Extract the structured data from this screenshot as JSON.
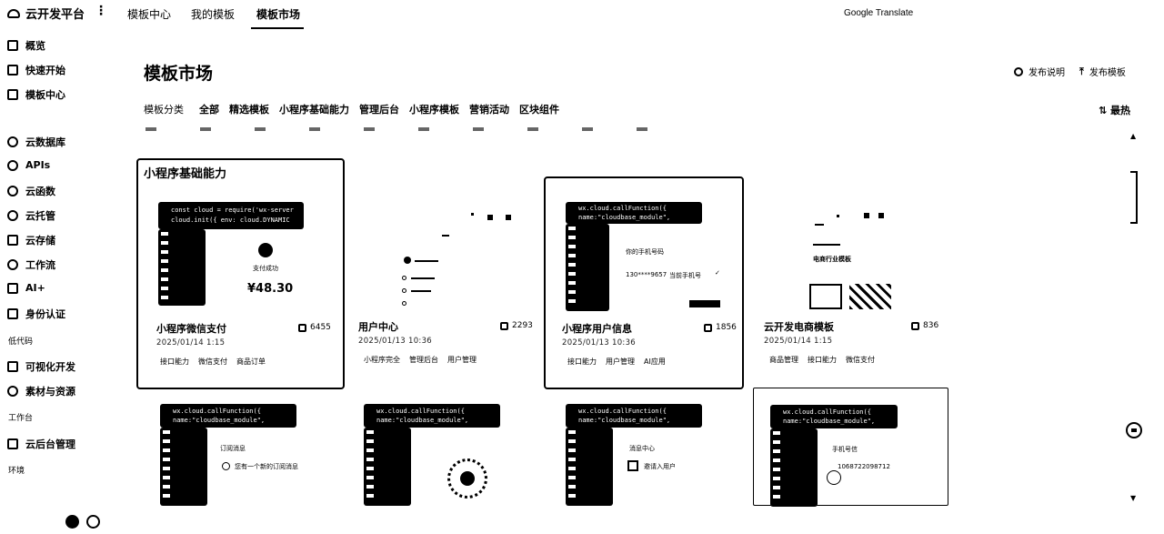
{
  "app": {
    "title": "云开发平台"
  },
  "top_tabs": [
    {
      "label": "模板中心"
    },
    {
      "label": "我的模板"
    },
    {
      "label": "模板市场"
    }
  ],
  "google_translate": "Google Translate",
  "sidebar": {
    "items_a": [
      {
        "label": "概览"
      },
      {
        "label": "快速开始"
      },
      {
        "label": "模板中心"
      }
    ],
    "items_b": [
      {
        "label": "云数据库"
      },
      {
        "label": "APIs"
      },
      {
        "label": "云函数"
      },
      {
        "label": "云托管"
      },
      {
        "label": "云存储"
      },
      {
        "label": "工作流"
      },
      {
        "label": "AI+"
      },
      {
        "label": "身份认证"
      }
    ],
    "section_lowcode": "低代码",
    "items_c": [
      {
        "label": "可视化开发"
      },
      {
        "label": "素材与资源"
      }
    ],
    "section_workbench": "工作台",
    "items_d": [
      {
        "label": "云后台管理"
      }
    ],
    "section_env": "环境"
  },
  "page": {
    "title": "模板市场",
    "help": "发布说明",
    "publish": "发布模板",
    "sort": "最热"
  },
  "filters": {
    "label": "模板分类",
    "options": [
      "全部",
      "精选模板",
      "小程序基础能力",
      "管理后台",
      "小程序模板",
      "营销活动",
      "区块组件"
    ]
  },
  "group_heading": "小程序基础能力",
  "cards": [
    {
      "title": "小程序微信支付",
      "count": "6455",
      "date": "2025/01/14 1:15",
      "tags": [
        "接口能力",
        "微信支付",
        "商品订单"
      ],
      "code1": "const cloud = require('wx-server",
      "code2": "cloud.init({ env: cloud.DYNAMIC",
      "pay_status": "支付成功",
      "price": "¥48.30"
    },
    {
      "title": "用户中心",
      "count": "2293",
      "date": "2025/01/13 10:36",
      "tags": [
        "小程序完全",
        "管理后台",
        "用户管理"
      ]
    },
    {
      "title": "小程序用户信息",
      "count": "1856",
      "date": "2025/01/13 10:36",
      "tags": [
        "接口能力",
        "用户管理",
        "AI应用"
      ],
      "code1": "wx.cloud.callFunction({",
      "code2": "name:\"cloudbase_module\",",
      "ui_label": "你的手机号码",
      "ui_phone": "130****9657",
      "ui_current": "当前手机号"
    },
    {
      "title": "云开发电商模板",
      "count": "836",
      "date": "2025/01/14 1:15",
      "tags": [
        "商品管理",
        "接口能力",
        "微信支付"
      ],
      "preview": "电商行业模板"
    },
    {
      "code1": "wx.cloud.callFunction({",
      "code2": "name:\"cloudbase_module\",",
      "ui_title": "订阅消息",
      "ui_row": "您有一个新的订阅消息"
    },
    {
      "code1": "wx.cloud.callFunction({",
      "code2": "name:\"cloudbase_module\","
    },
    {
      "code1": "wx.cloud.callFunction({",
      "code2": "name:\"cloudbase_module\",",
      "ui_title": "消息中心",
      "ui_row": "邀请入用户"
    },
    {
      "code1": "wx.cloud.callFunction({",
      "code2": "name:\"cloudbase_module\",",
      "ui_title": "手机号信",
      "ui_phone": "1068722098712"
    }
  ]
}
